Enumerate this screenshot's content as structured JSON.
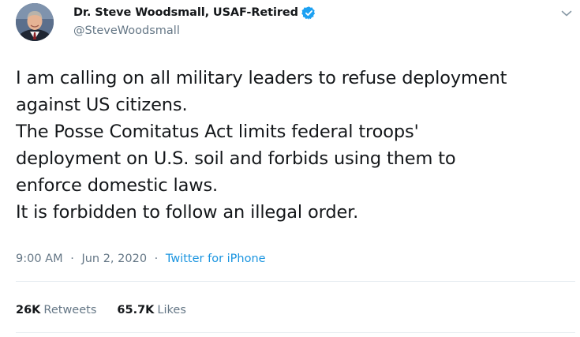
{
  "author": {
    "display_name": "Dr. Steve Woodsmall, USAF-Retired",
    "handle": "@SteveWoodsmall",
    "verified": true,
    "verified_icon": "verified-badge-icon",
    "avatar_icon": "profile-photo"
  },
  "menu_icon": "chevron-down-icon",
  "tweet": {
    "lines": [
      "I am calling on all military leaders to refuse deployment",
      "against US citizens.",
      "The Posse Comitatus Act limits federal troops'",
      "deployment on U.S. soil and forbids using them to",
      "enforce domestic laws.",
      "It is forbidden to follow an illegal order."
    ]
  },
  "meta": {
    "time": "9:00 AM",
    "date": "Jun 2, 2020",
    "separator": "·",
    "source": "Twitter for iPhone"
  },
  "stats": {
    "retweets_count": "26K",
    "retweets_label": "Retweets",
    "likes_count": "65.7K",
    "likes_label": "Likes"
  },
  "colors": {
    "text": "#14171a",
    "secondary": "#657786",
    "link": "#1b95e0",
    "verified": "#1da1f2",
    "divider": "#e6ecf0"
  }
}
